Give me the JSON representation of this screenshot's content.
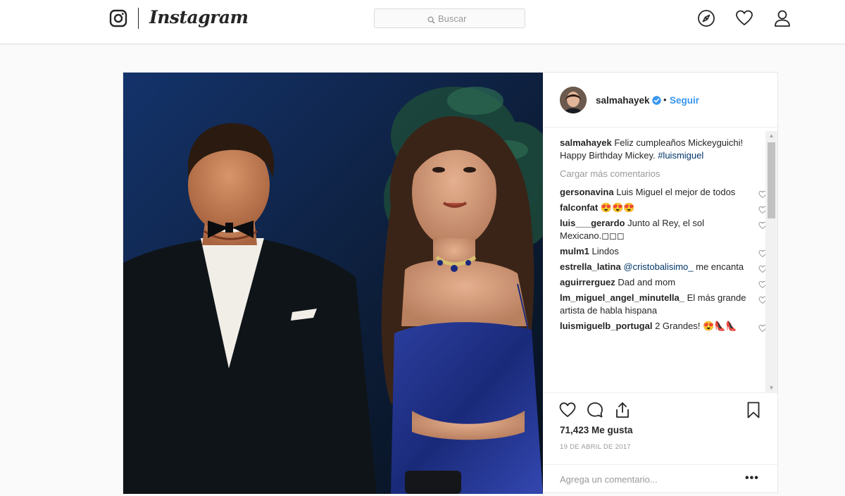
{
  "topbar": {
    "wordmark": "Instagram",
    "logo_icon": "instagram-glyph-icon",
    "search_placeholder": "Buscar",
    "nav_icons": [
      "compass-icon",
      "heart-icon",
      "profile-icon"
    ]
  },
  "post": {
    "username": "salmahayek",
    "verified": true,
    "separator": "•",
    "follow_label": "Seguir",
    "caption": {
      "user": "salmahayek",
      "text": "Feliz cumpleaños Mickeyguichi! Happy Birthday Mickey. ",
      "hashtag": "#luismiguel"
    },
    "load_more_label": "Cargar más comentarios",
    "comments": [
      {
        "user": "gersonavina",
        "text": "Luis Miguel el mejor de todos"
      },
      {
        "user": "falconfat",
        "text": "😍😍😍"
      },
      {
        "user": "luis___gerardo",
        "text": "Junto al Rey, el sol Mexicano.◻◻◻"
      },
      {
        "user": "mulm1",
        "text": "Lindos"
      },
      {
        "user": "estrella_latina",
        "mention": "@cristobalisimo_",
        "text": " me encanta"
      },
      {
        "user": "aguirrerguez",
        "text": "Dad and mom"
      },
      {
        "user": "lm_miguel_angel_minutella_",
        "text": "El más grande artista de habla hispana"
      },
      {
        "user": "luismiguelb_portugal",
        "text": "2 Grandes! 😍👠👠"
      }
    ],
    "likes": "71,423 Me gusta",
    "date": "19 DE ABRIL DE 2017",
    "add_comment_placeholder": "Agrega un comentario...",
    "more_label": "•••",
    "action_icons": [
      "heart-icon",
      "comment-icon",
      "share-icon",
      "bookmark-icon"
    ]
  },
  "colors": {
    "link_blue": "#3897f0",
    "hashtag_blue": "#003569",
    "text": "#262626",
    "muted": "#999999",
    "border": "#dbdbdb",
    "background": "#fafafa"
  }
}
